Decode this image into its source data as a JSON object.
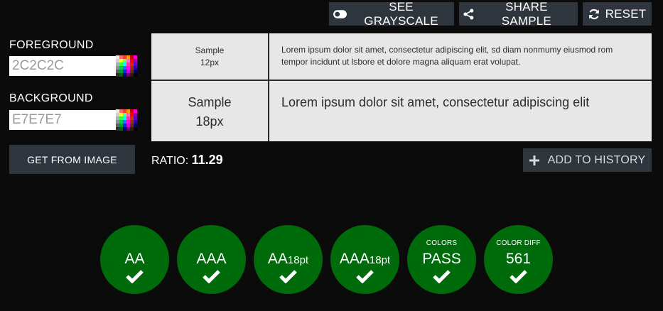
{
  "toolbar": {
    "grayscale_label": "SEE GRAYSCALE",
    "share_label": "SHARE SAMPLE",
    "reset_label": "RESET"
  },
  "foreground": {
    "label": "FOREGROUND",
    "value": "2C2C2C"
  },
  "background": {
    "label": "BACKGROUND",
    "value": "E7E7E7"
  },
  "get_from_image_label": "GET FROM IMAGE",
  "sample": {
    "small_title": "Sample",
    "small_size": "12px",
    "small_text": "Lorem ipsum dolor sit amet, consectetur adipiscing elit, sd diam nonmumy eiusmod rom tempor incidunt ut lsbore et dolore magna aliquam erat volupat.",
    "large_title": "Sample",
    "large_size": "18px",
    "large_text": "Lorem ipsum dolor sit amet, consectetur adipiscing elit"
  },
  "ratio": {
    "label": "RATIO:",
    "value": "11.29"
  },
  "add_history_label": "ADD TO HISTORY",
  "results": [
    {
      "main": "AA",
      "suffix": "",
      "top": ""
    },
    {
      "main": "AAA",
      "suffix": "",
      "top": ""
    },
    {
      "main": "AA",
      "suffix": "18pt",
      "top": ""
    },
    {
      "main": "AAA",
      "suffix": "18pt",
      "top": ""
    },
    {
      "main": "PASS",
      "suffix": "",
      "top": "COLORS"
    },
    {
      "main": "561",
      "suffix": "",
      "top": "COLOR DIFF"
    }
  ],
  "colors": {
    "background": "#0b0b0b",
    "button": "#2f353d",
    "pass_green": "#006b0a",
    "sample_bg": "#e7e7e7",
    "sample_fg": "#2c2c2c"
  }
}
